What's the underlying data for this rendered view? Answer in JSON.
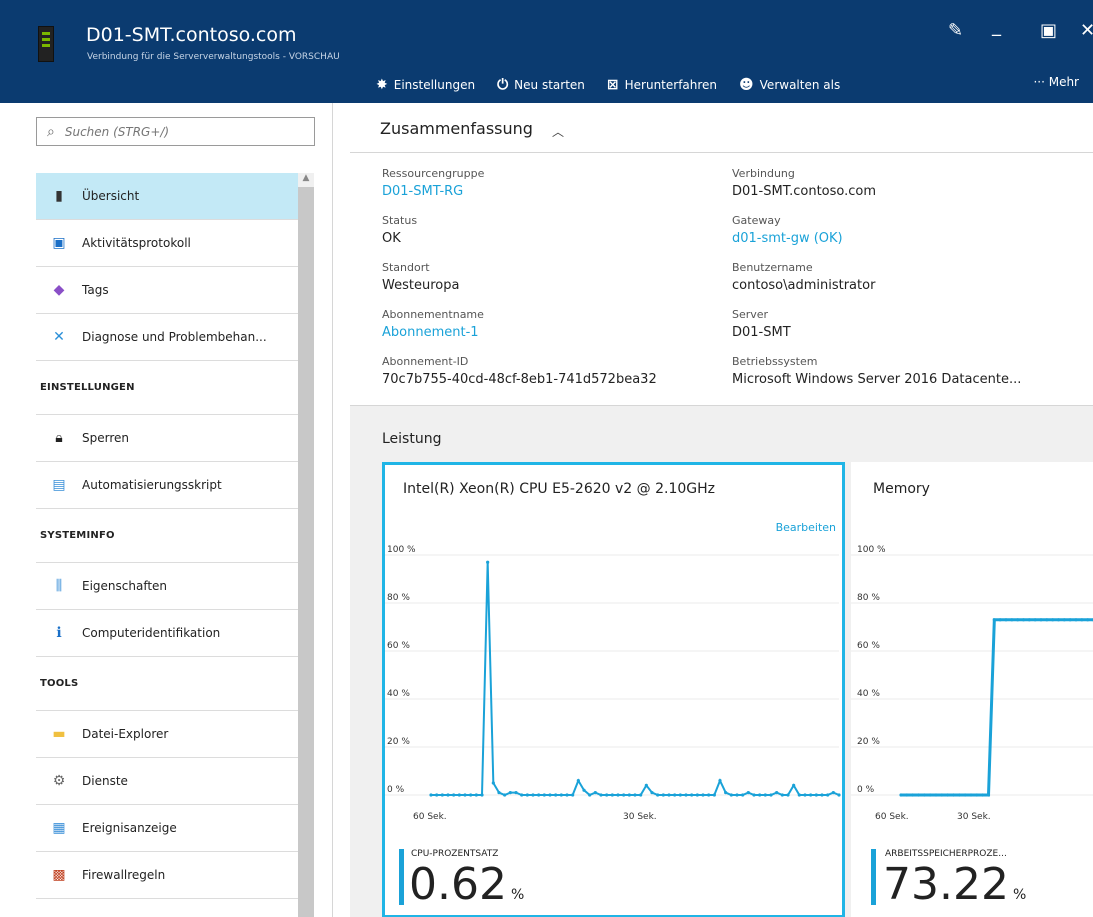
{
  "header": {
    "title": "D01-SMT.contoso.com",
    "subtitle": "Verbindung für die Serververwaltungstools - VORSCHAU",
    "toolbar": [
      {
        "icon": "gear-icon",
        "glyph": "✸",
        "label": "Einstellungen"
      },
      {
        "icon": "power-icon",
        "glyph": "⏻",
        "label": "Neu starten"
      },
      {
        "icon": "shutdown-icon",
        "glyph": "⊠",
        "label": "Herunterfahren"
      },
      {
        "icon": "user-icon",
        "glyph": "☻",
        "label": "Verwalten als"
      }
    ],
    "more_label": "··· Mehr"
  },
  "sidebar": {
    "search_placeholder": "Suchen (STRG+/)",
    "items_top": [
      {
        "label": "Übersicht",
        "icon": "server-icon",
        "glyph": "▮",
        "color": "#333333",
        "active": true
      },
      {
        "label": "Aktivitätsprotokoll",
        "icon": "log-icon",
        "glyph": "▣",
        "color": "#1a6fc7",
        "active": false
      },
      {
        "label": "Tags",
        "icon": "tag-icon",
        "glyph": "◆",
        "color": "#8a4fc7",
        "active": false
      },
      {
        "label": "Diagnose und Problembehan...",
        "icon": "tools-icon",
        "glyph": "✕",
        "color": "#2a8fd8",
        "active": false
      }
    ],
    "sections": [
      {
        "title": "EINSTELLUNGEN",
        "items": [
          {
            "label": "Sperren",
            "icon": "lock-icon",
            "glyph": "🔒︎",
            "color": "#222222"
          },
          {
            "label": "Automatisierungsskript",
            "icon": "script-icon",
            "glyph": "▤",
            "color": "#3a8fd8"
          }
        ]
      },
      {
        "title": "SYSTEMINFO",
        "items": [
          {
            "label": "Eigenschaften",
            "icon": "properties-icon",
            "glyph": "⫼",
            "color": "#3a8fd8"
          },
          {
            "label": "Computeridentifikation",
            "icon": "info-icon",
            "glyph": "ℹ",
            "color": "#1a6fc7"
          }
        ]
      },
      {
        "title": "TOOLS",
        "items": [
          {
            "label": "Datei-Explorer",
            "icon": "folder-icon",
            "glyph": "▬",
            "color": "#f0c040"
          },
          {
            "label": "Dienste",
            "icon": "services-icon",
            "glyph": "⚙",
            "color": "#666666"
          },
          {
            "label": "Ereignisanzeige",
            "icon": "event-icon",
            "glyph": "▦",
            "color": "#3a8fd8"
          },
          {
            "label": "Firewallregeln",
            "icon": "firewall-icon",
            "glyph": "▩",
            "color": "#c04020"
          }
        ]
      }
    ]
  },
  "summary": {
    "title": "Zusammenfassung",
    "left": [
      {
        "label": "Ressourcengruppe",
        "value": "D01-SMT-RG",
        "link": true
      },
      {
        "label": "Status",
        "value": "OK",
        "link": false
      },
      {
        "label": "Standort",
        "value": "Westeuropa",
        "link": false
      },
      {
        "label": "Abonnementname",
        "value": "Abonnement-1",
        "link": true
      },
      {
        "label": "Abonnement-ID",
        "value": "70c7b755-40cd-48cf-8eb1-741d572bea32",
        "link": false
      }
    ],
    "right": [
      {
        "label": "Verbindung",
        "value": "D01-SMT.contoso.com",
        "link": false
      },
      {
        "label": "Gateway",
        "value": "d01-smt-gw (OK)",
        "link": true
      },
      {
        "label": "Benutzername",
        "value": "contoso\\administrator",
        "link": false
      },
      {
        "label": "Server",
        "value": "D01-SMT",
        "link": false
      },
      {
        "label": "Betriebssystem",
        "value": "Microsoft Windows Server 2016 Datacente...",
        "link": false
      }
    ]
  },
  "performance": {
    "title": "Leistung",
    "edit_label": "Bearbeiten",
    "accent": "#1aa2d8"
  },
  "chart_data": [
    {
      "type": "line",
      "title": "Intel(R) Xeon(R) CPU E5-2620 v2 @ 2.10GHz",
      "x_ticks": [
        "60 Sek.",
        "30 Sek."
      ],
      "y_ticks": [
        "100 %",
        "80 %",
        "60 %",
        "40 %",
        "20 %",
        "0 %"
      ],
      "ylim": [
        0,
        100
      ],
      "xlim": [
        0,
        72
      ],
      "values": [
        0,
        0,
        0,
        0,
        0,
        0,
        0,
        0,
        0,
        0,
        97,
        5,
        1,
        0,
        1,
        1,
        0,
        0,
        0,
        0,
        0,
        0,
        0,
        0,
        0,
        0,
        6,
        2,
        0,
        1,
        0,
        0,
        0,
        0,
        0,
        0,
        0,
        0,
        4,
        1,
        0,
        0,
        0,
        0,
        0,
        0,
        0,
        0,
        0,
        0,
        0,
        6,
        1,
        0,
        0,
        0,
        1,
        0,
        0,
        0,
        0,
        1,
        0,
        0,
        4,
        0,
        0,
        0,
        0,
        0,
        0,
        1,
        0
      ],
      "metric_label": "CPU-PROZENTSATZ",
      "metric_value": "0.62",
      "metric_unit": "%"
    },
    {
      "type": "line",
      "title": "Memory",
      "x_ticks": [
        "60 Sek.",
        "30 Sek."
      ],
      "y_ticks": [
        "100 %",
        "80 %",
        "60 %",
        "40 %",
        "20 %",
        "0 %"
      ],
      "ylim": [
        0,
        100
      ],
      "xlim": [
        0,
        72
      ],
      "values": [
        0,
        0,
        0,
        0,
        0,
        0,
        0,
        0,
        0,
        0,
        0,
        0,
        0,
        0,
        0,
        0,
        73,
        73,
        73,
        73,
        73,
        73,
        73,
        73,
        73,
        73,
        73,
        73,
        73,
        73,
        73,
        73,
        73,
        73,
        73,
        73,
        73,
        73,
        73,
        73,
        73,
        73,
        73,
        73,
        73,
        73,
        73,
        73,
        73,
        72.8,
        72.8,
        72.8,
        72.8,
        72.6,
        72.6,
        72.6,
        72.6
      ],
      "metric_label": "ARBEITSSPEICHERPROZE...",
      "metric_value": "73.22",
      "metric_unit": "%"
    }
  ]
}
